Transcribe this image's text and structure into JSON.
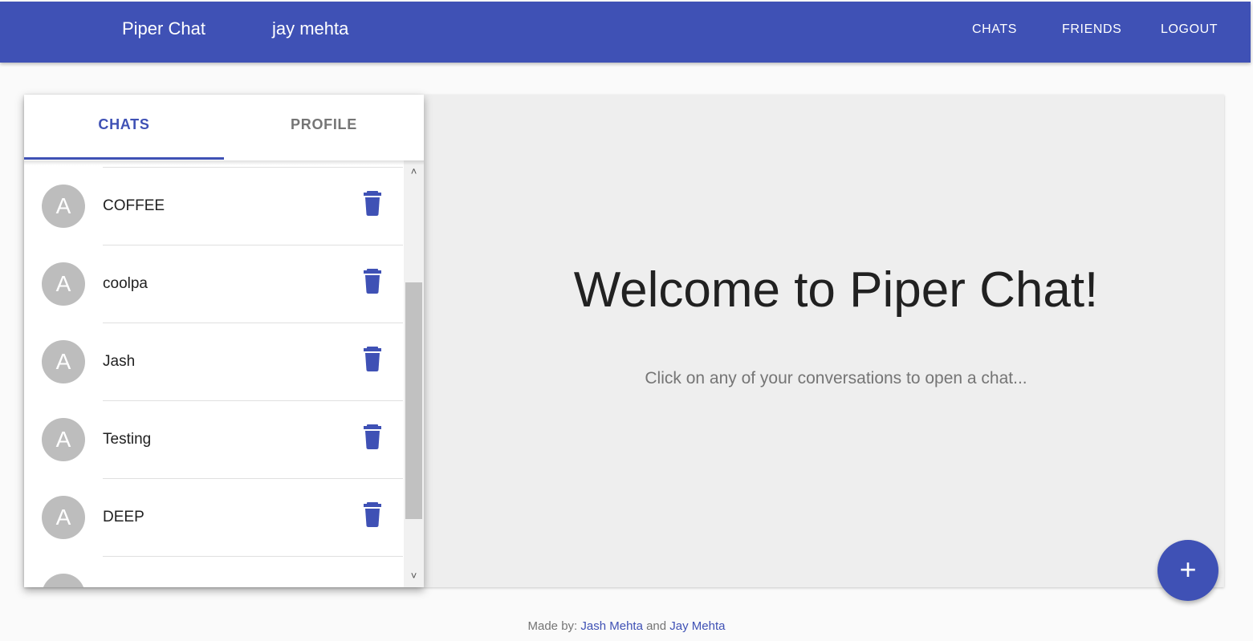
{
  "header": {
    "brand": "Piper Chat",
    "user_name": "jay mehta",
    "nav": {
      "chats": "CHATS",
      "friends": "FRIENDS",
      "logout": "LOGOUT"
    },
    "color": "#3f51b5"
  },
  "sidebar": {
    "tabs": {
      "chats": "CHATS",
      "profile": "PROFILE"
    },
    "active_tab": "CHATS",
    "chats": [
      {
        "name": "COFFEE",
        "avatar": "A"
      },
      {
        "name": "coolpa",
        "avatar": "A"
      },
      {
        "name": "Jash",
        "avatar": "A"
      },
      {
        "name": "Testing",
        "avatar": "A"
      },
      {
        "name": "DEEP",
        "avatar": "A"
      }
    ],
    "delete_icon": "trash-icon",
    "scroll": {
      "up_icon": "˄",
      "down_icon": "˅"
    }
  },
  "main": {
    "welcome": "Welcome to Piper Chat!",
    "subtitle": "Click on any of your conversations to open a chat..."
  },
  "fab": {
    "label": "+",
    "icon": "plus-icon"
  },
  "footer": {
    "prefix": "Made by:",
    "author1": "Jash Mehta",
    "conjunction": "and",
    "author2": "Jay Mehta"
  }
}
